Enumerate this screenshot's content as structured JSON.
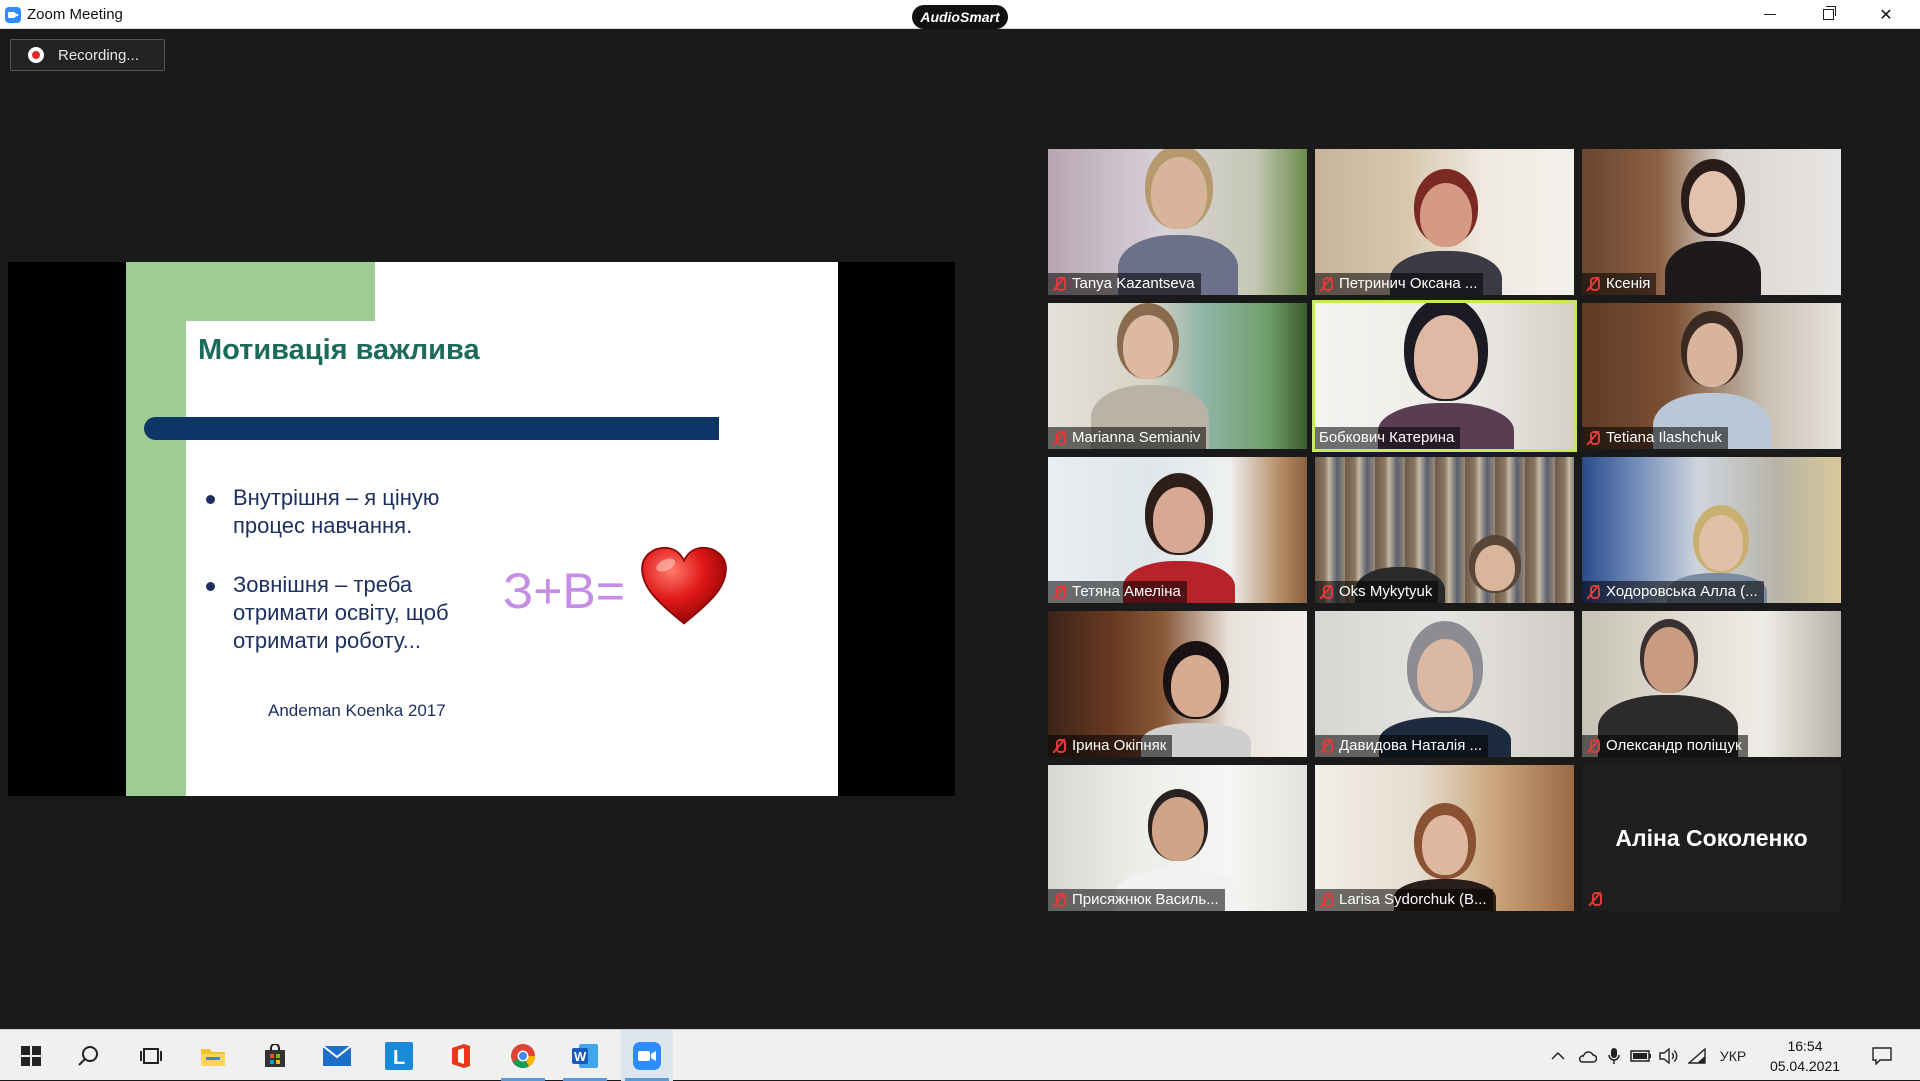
{
  "window": {
    "title": "Zoom Meeting",
    "badge": "AudioSmart"
  },
  "recording": {
    "label": "Recording..."
  },
  "slide": {
    "title": "Мотивація важлива",
    "bullets": [
      "Внутрішня – я ціную процес навчання.",
      "Зовнішня – треба отримати освіту, щоб отримати роботу..."
    ],
    "formula": "З+В=",
    "author": "Andeman Koenka 2017",
    "colors": {
      "accent_green": "#9dcc95",
      "title_teal": "#1b6a5c",
      "bar_navy": "#0d3566",
      "formula_violet": "#c58de6"
    }
  },
  "participants": [
    {
      "name": "Tanya Kazantseva",
      "muted": true
    },
    {
      "name": "Петринич Оксана ...",
      "muted": true
    },
    {
      "name": "Ксенія",
      "muted": true
    },
    {
      "name": "Marianna Semianiv",
      "muted": true
    },
    {
      "name": "Бобкович Катерина",
      "muted": false,
      "active_speaker": true
    },
    {
      "name": "Tetiana Ilashchuk",
      "muted": true
    },
    {
      "name": "Тетяна Амеліна",
      "muted": true
    },
    {
      "name": "Oks Mykytyuk",
      "muted": true
    },
    {
      "name": "Ходоровська Алла (...",
      "muted": true
    },
    {
      "name": "Ірина Окіпняк",
      "muted": true
    },
    {
      "name": "Давидова Наталія ...",
      "muted": true
    },
    {
      "name": "Олександр поліщук",
      "muted": true
    },
    {
      "name": "Присяжнюк Василь...",
      "muted": true
    },
    {
      "name": "Larisa Sydorchuk (B...",
      "muted": true
    },
    {
      "name": "Аліна Соколенко",
      "muted": true,
      "video_off": true
    }
  ],
  "taskbar": {
    "items": [
      "start",
      "search",
      "task-view",
      "file-explorer",
      "store",
      "mail",
      "l-app",
      "office",
      "chrome",
      "word",
      "zoom"
    ],
    "tray": {
      "language": "УКР",
      "time": "16:54",
      "date": "05.04.2021"
    }
  }
}
